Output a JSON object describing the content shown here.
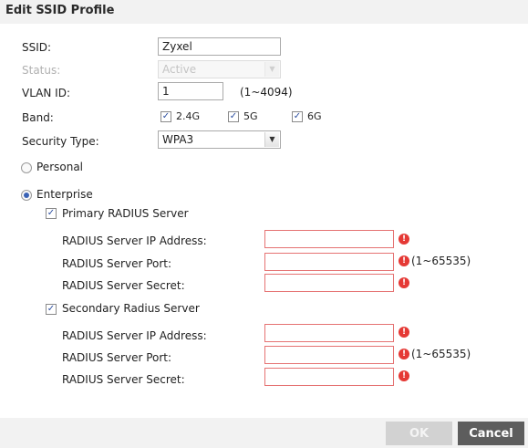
{
  "dialog": {
    "title": "Edit SSID Profile"
  },
  "form": {
    "ssid_label": "SSID:",
    "ssid_value": "Zyxel",
    "status_label": "Status:",
    "status_value": "Active",
    "vlan_label": "VLAN ID:",
    "vlan_value": "1",
    "vlan_range": "(1~4094)",
    "band_label": "Band:",
    "bands": [
      {
        "label": "2.4G",
        "checked": true
      },
      {
        "label": "5G",
        "checked": true
      },
      {
        "label": "6G",
        "checked": true
      }
    ],
    "security_label": "Security Type:",
    "security_value": "WPA3"
  },
  "mode": {
    "personal_label": "Personal",
    "personal_selected": false,
    "enterprise_label": "Enterprise",
    "enterprise_selected": true
  },
  "primary": {
    "checkbox_label": "Primary RADIUS Server",
    "checked": true,
    "ip_label": "RADIUS Server IP Address:",
    "ip_value": "",
    "port_label": "RADIUS Server Port:",
    "port_value": "",
    "port_range": "(1~65535)",
    "secret_label": "RADIUS Server Secret:",
    "secret_value": ""
  },
  "secondary": {
    "checkbox_label": "Secondary Radius Server",
    "checked": true,
    "ip_label": "RADIUS Server IP Address:",
    "ip_value": "",
    "port_label": "RADIUS Server Port:",
    "port_value": "",
    "port_range": "(1~65535)",
    "secret_label": "RADIUS Server Secret:",
    "secret_value": ""
  },
  "icons": {
    "check": "✓",
    "warning": "!"
  },
  "buttons": {
    "ok": "OK",
    "cancel": "Cancel"
  },
  "colors": {
    "error_border": "#e57373",
    "warning_icon": "#e53935",
    "cancel_bg": "#5d5d5d",
    "ok_disabled_bg": "#d2d2d2"
  }
}
